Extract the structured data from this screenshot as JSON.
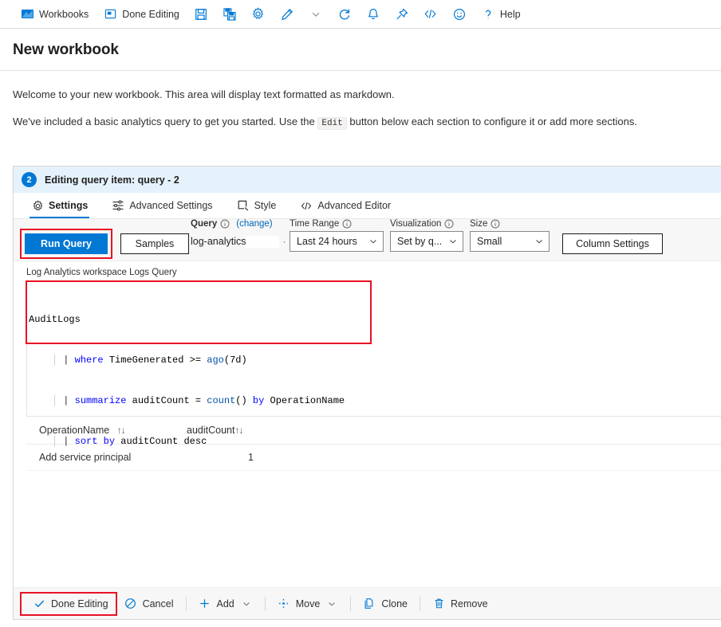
{
  "toolbar": {
    "items": [
      {
        "label": "Workbooks",
        "icon": "workbooks-icon"
      },
      {
        "label": "Done Editing",
        "icon": "done-editing-icon"
      },
      {
        "label": "",
        "icon": "save-icon"
      },
      {
        "label": "",
        "icon": "save-as-icon"
      },
      {
        "label": "",
        "icon": "gear-icon"
      },
      {
        "label": "",
        "icon": "edit-pencil-icon"
      },
      {
        "label": "",
        "icon": "chevron-down-icon"
      },
      {
        "label": "",
        "icon": "refresh-icon"
      },
      {
        "label": "",
        "icon": "alert-bell-icon"
      },
      {
        "label": "",
        "icon": "pin-icon"
      },
      {
        "label": "",
        "icon": "code-brackets-icon"
      },
      {
        "label": "",
        "icon": "smiley-feedback-icon"
      },
      {
        "label": "Help",
        "icon": "question-help-icon"
      }
    ]
  },
  "page": {
    "title": "New workbook",
    "paragraph1": "Welcome to your new workbook. This area will display text formatted as markdown.",
    "paragraph2_before": "We've included a basic analytics query to get you started. Use the ",
    "paragraph2_code": "Edit",
    "paragraph2_after": " button below each section to configure it or add more sections."
  },
  "panel": {
    "badge": "2",
    "header_title": "Editing query item: query - 2",
    "tabs": [
      {
        "label": "Settings",
        "icon": "gear-icon",
        "active": true
      },
      {
        "label": "Advanced Settings",
        "icon": "sliders-icon",
        "active": false
      },
      {
        "label": "Style",
        "icon": "style-square-icon",
        "active": false
      },
      {
        "label": "Advanced Editor",
        "icon": "code-brackets-icon",
        "active": false
      }
    ]
  },
  "query_toolbar": {
    "run_query_label": "Run Query",
    "samples_label": "Samples",
    "query_label": "Query",
    "query_change_link": "(change)",
    "query_source_value": "log-analytics",
    "time_range_label": "Time Range",
    "time_range_value": "Last 24 hours",
    "visualization_label": "Visualization",
    "visualization_value": "Set by q...",
    "size_label": "Size",
    "size_value": "Small",
    "column_settings_label": "Column Settings"
  },
  "editor": {
    "caption": "Log Analytics workspace Logs Query",
    "lines": [
      {
        "tokens": [
          {
            "t": "AuditLogs",
            "c": "plain"
          }
        ]
      },
      {
        "tokens": [
          {
            "t": "    ",
            "c": "plain"
          },
          {
            "t": "| ",
            "c": "pipe"
          },
          {
            "t": "where",
            "c": "kw"
          },
          {
            "t": " TimeGenerated >= ",
            "c": "plain"
          },
          {
            "t": "ago",
            "c": "fn"
          },
          {
            "t": "(7d)",
            "c": "plain"
          }
        ]
      },
      {
        "tokens": [
          {
            "t": "    ",
            "c": "plain"
          },
          {
            "t": "| ",
            "c": "pipe"
          },
          {
            "t": "summarize",
            "c": "kw"
          },
          {
            "t": " auditCount = ",
            "c": "plain"
          },
          {
            "t": "count",
            "c": "fn"
          },
          {
            "t": "() ",
            "c": "plain"
          },
          {
            "t": "by",
            "c": "kw"
          },
          {
            "t": " OperationName",
            "c": "plain"
          }
        ]
      },
      {
        "tokens": [
          {
            "t": "    ",
            "c": "plain"
          },
          {
            "t": "| ",
            "c": "pipe"
          },
          {
            "t": "sort",
            "c": "kw"
          },
          {
            "t": " ",
            "c": "plain"
          },
          {
            "t": "by",
            "c": "kw"
          },
          {
            "t": " auditCount desc",
            "c": "plain"
          }
        ]
      }
    ]
  },
  "results": {
    "columns": [
      {
        "label": "OperationName",
        "sort_glyph": "↑↓"
      },
      {
        "label": "auditCount",
        "sort_glyph": "↑↓"
      }
    ],
    "rows": [
      {
        "OperationName": "Add service principal",
        "auditCount": "1"
      }
    ]
  },
  "bottom_bar": {
    "items": [
      {
        "label": "Done Editing",
        "icon": "checkmark-icon",
        "has_chevron": false
      },
      {
        "label": "Cancel",
        "icon": "cancel-circle-icon",
        "has_chevron": false
      },
      {
        "label": "Add",
        "icon": "plus-icon",
        "has_chevron": true
      },
      {
        "label": "Move",
        "icon": "move-arrows-icon",
        "has_chevron": true
      },
      {
        "label": "Clone",
        "icon": "clone-copy-icon",
        "has_chevron": false
      },
      {
        "label": "Remove",
        "icon": "trash-icon",
        "has_chevron": false
      }
    ]
  },
  "colors": {
    "accent": "#0078d4",
    "panel_header_bg": "#e5f2fc",
    "annotation_red": "#e81123",
    "link": "#0067b8",
    "toolbar_bg": "#f7f7f7"
  }
}
